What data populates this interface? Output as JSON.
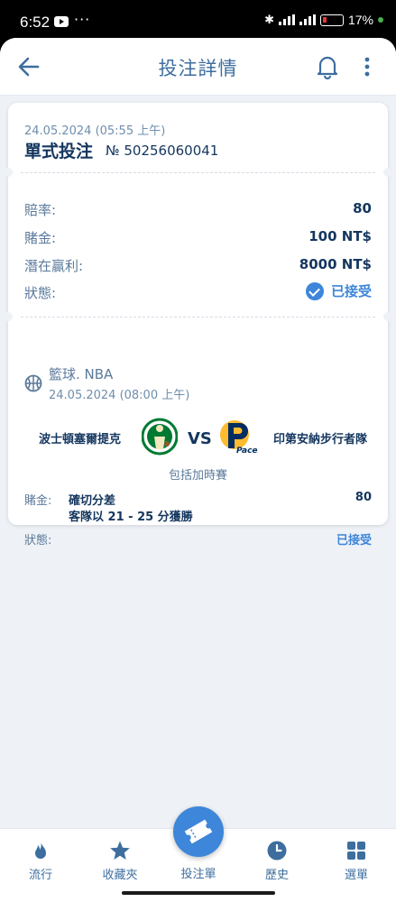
{
  "status_bar": {
    "time": "6:52",
    "dots": "···",
    "battery": "17%"
  },
  "header": {
    "title": "投注詳情",
    "back_icon": "arrow-left-icon",
    "bell_icon": "bell-icon",
    "more_icon": "more-vertical-icon"
  },
  "bet": {
    "date": "24.05.2024 (05:55 上午)",
    "type": "單式投注",
    "number": "№ 50256060041",
    "rows": [
      {
        "label": "賠率:",
        "value": "80"
      },
      {
        "label": "賭金:",
        "value": "100 NT$"
      },
      {
        "label": "潛在贏利:",
        "value": "8000 NT$"
      },
      {
        "label": "狀態:",
        "value": "已接受"
      }
    ]
  },
  "match": {
    "sport": "籃球. NBA",
    "date": "24.05.2024 (08:00 上午)",
    "home_team": "波士頓塞爾提克",
    "away_team": "印第安納步行者隊",
    "vs": "VS",
    "away_logo_text": "Pacers",
    "overtime_note": "包括加時賽",
    "selection_label": "賭金:",
    "market": "確切分差",
    "outcome": "客隊以 21 - 25 分獲勝",
    "odds": "80",
    "status_label": "狀態:",
    "status": "已接受"
  },
  "nav": {
    "items": [
      {
        "label": "流行",
        "icon": "flame-icon"
      },
      {
        "label": "收藏夾",
        "icon": "star-icon"
      },
      {
        "label": "投注單",
        "icon": "ticket-icon"
      },
      {
        "label": "歷史",
        "icon": "clock-icon"
      },
      {
        "label": "選單",
        "icon": "grid-icon"
      }
    ]
  },
  "colors": {
    "primary": "#3d86d9",
    "title_text": "#3d6e9e",
    "dark_text": "#14365e",
    "background": "#eef1f6"
  }
}
